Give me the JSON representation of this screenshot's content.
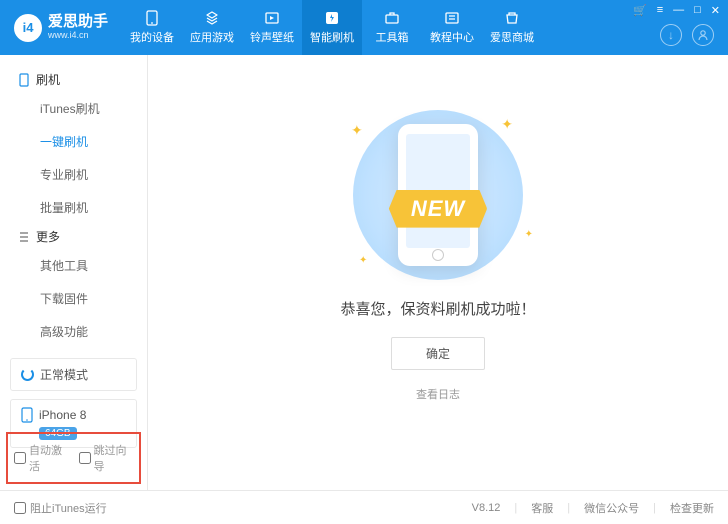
{
  "logo": {
    "badge": "i4",
    "title": "爱思助手",
    "sub": "www.i4.cn"
  },
  "nav": [
    {
      "label": "我的设备",
      "icon": "device"
    },
    {
      "label": "应用游戏",
      "icon": "apps"
    },
    {
      "label": "铃声壁纸",
      "icon": "media"
    },
    {
      "label": "智能刷机",
      "icon": "flash",
      "active": true
    },
    {
      "label": "工具箱",
      "icon": "tools"
    },
    {
      "label": "教程中心",
      "icon": "tutorial"
    },
    {
      "label": "爱思商城",
      "icon": "store"
    }
  ],
  "sidebar": {
    "groups": [
      {
        "title": "刷机",
        "icon": "phone",
        "items": [
          {
            "label": "iTunes刷机"
          },
          {
            "label": "一键刷机",
            "active": true
          },
          {
            "label": "专业刷机"
          },
          {
            "label": "批量刷机"
          }
        ]
      },
      {
        "title": "更多",
        "icon": "list",
        "items": [
          {
            "label": "其他工具"
          },
          {
            "label": "下载固件"
          },
          {
            "label": "高级功能"
          }
        ]
      }
    ],
    "status": "正常模式",
    "device": {
      "name": "iPhone 8",
      "capacity": "64GB"
    },
    "checks": {
      "autoActivate": "自动激活",
      "skipGuide": "跳过向导"
    }
  },
  "main": {
    "ribbon": "NEW",
    "message": "恭喜您，保资料刷机成功啦！",
    "ok": "确定",
    "viewLog": "查看日志"
  },
  "footer": {
    "blockItunes": "阻止iTunes运行",
    "version": "V8.12",
    "support": "客服",
    "wechat": "微信公众号",
    "update": "检查更新"
  }
}
